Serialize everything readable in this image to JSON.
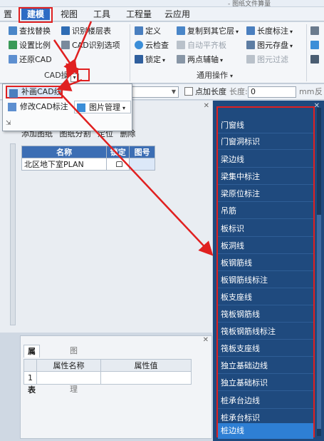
{
  "titlebar": {
    "text": "- 图纸文件算量"
  },
  "menu": [
    "置",
    "建模",
    "视图",
    "工具",
    "工程量",
    "云应用"
  ],
  "ribbon": {
    "col1": [
      "查找替换",
      "设置比例",
      "还原CAD"
    ],
    "col2": [
      "识别楼层表",
      "CAD识别选项"
    ],
    "group1_label": "CAD操",
    "col3": [
      "定义",
      "云检查",
      "锁定"
    ],
    "col4": [
      "复制到其它层",
      "自动平齐板",
      "两点辅轴"
    ],
    "col5": [
      "长度标注",
      "图元存盘",
      "图元过滤"
    ],
    "group2_label": "通用操作"
  },
  "options": {
    "point_length": "点加长度",
    "length_label": "长度:",
    "length_value": "0",
    "unit": "mm",
    "reverse": "反"
  },
  "popup": {
    "items": [
      "补画CAD线",
      "修改CAD标注",
      "图片管理"
    ]
  },
  "drawing_panel": {
    "tools": [
      "添加图纸",
      "图纸分割",
      "定位",
      "删除"
    ],
    "columns": [
      "名称",
      "锁定",
      "图号"
    ],
    "rows": [
      [
        "北区地下室PLAN",
        "",
        ""
      ]
    ]
  },
  "property_panel": {
    "tabs": [
      "属性列表",
      "图层管理"
    ],
    "columns": [
      "属性名称",
      "属性值"
    ],
    "rows": [
      [
        "1",
        "",
        ""
      ]
    ]
  },
  "layers": [
    "门窗线",
    "门窗洞标识",
    "梁边线",
    "梁集中标注",
    "梁原位标注",
    "吊筋",
    "板标识",
    "板洞线",
    "板钢筋线",
    "板钢筋线标注",
    "板支座线",
    "筏板钢筋线",
    "筏板钢筋线标注",
    "筏板支座线",
    "独立基础边线",
    "独立基础标识",
    "桩承台边线",
    "桩承台标识",
    "桩边线"
  ],
  "selected_layer": "桩边线",
  "colors": {
    "accent": "#2d6bc4",
    "highlight": "#e02020",
    "layer_bg": "#1f4a7e",
    "layer_sel": "#2e7fd4"
  }
}
